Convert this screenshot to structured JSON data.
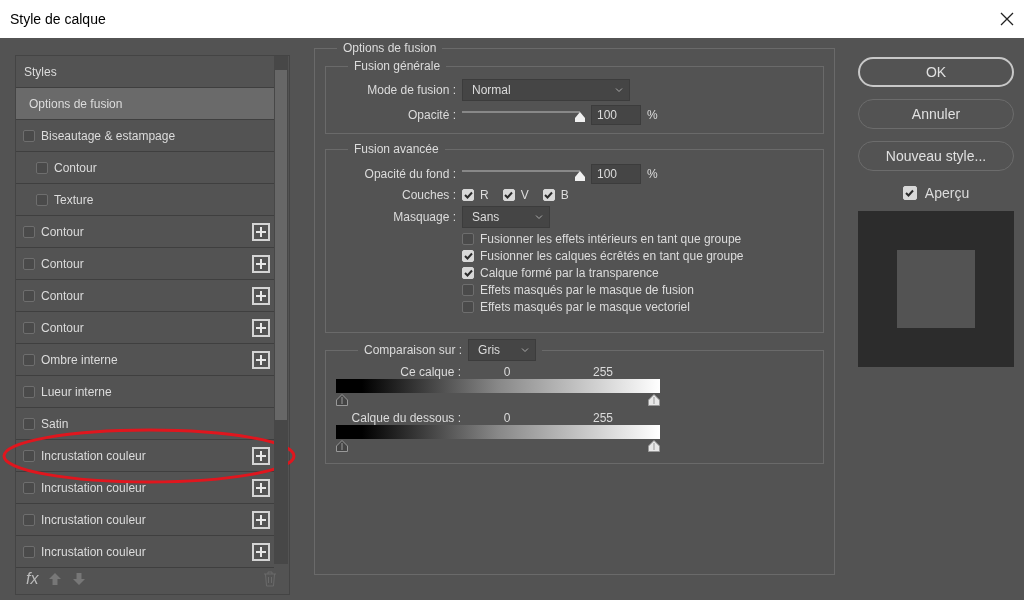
{
  "window": {
    "title": "Style de calque"
  },
  "styles_panel": {
    "header": "Styles",
    "fx": "fx",
    "items": [
      {
        "label": "Options de fusion",
        "kind": "page",
        "selected": true,
        "circled": false
      },
      {
        "label": "Biseautage & estampage",
        "kind": "effect",
        "checked": false,
        "selected": false,
        "circled": false,
        "children": [
          {
            "label": "Contour",
            "checked": false,
            "selected": false
          },
          {
            "label": "Texture",
            "checked": false,
            "selected": false
          }
        ]
      },
      {
        "label": "Contour",
        "kind": "stackable",
        "checked": false,
        "selected": false,
        "circled": false
      },
      {
        "label": "Contour",
        "kind": "stackable",
        "checked": false,
        "selected": false,
        "circled": false
      },
      {
        "label": "Contour",
        "kind": "stackable",
        "checked": false,
        "selected": false,
        "circled": false
      },
      {
        "label": "Contour",
        "kind": "stackable",
        "checked": false,
        "selected": false,
        "circled": false
      },
      {
        "label": "Ombre interne",
        "kind": "stackable",
        "checked": false,
        "selected": false,
        "circled": false
      },
      {
        "label": "Lueur interne",
        "kind": "effect",
        "checked": false,
        "selected": false,
        "circled": false
      },
      {
        "label": "Satin",
        "kind": "effect",
        "checked": false,
        "selected": false,
        "circled": false
      },
      {
        "label": "Incrustation couleur",
        "kind": "stackable",
        "checked": false,
        "selected": false,
        "circled": true
      },
      {
        "label": "Incrustation couleur",
        "kind": "stackable",
        "checked": false,
        "selected": false,
        "circled": false
      },
      {
        "label": "Incrustation couleur",
        "kind": "stackable",
        "checked": false,
        "selected": false,
        "circled": false
      },
      {
        "label": "Incrustation couleur",
        "kind": "stackable",
        "checked": false,
        "selected": false,
        "circled": false
      }
    ]
  },
  "blending": {
    "title": "Options de fusion",
    "general": {
      "title": "Fusion générale",
      "mode_label": "Mode de fusion :",
      "mode_value": "Normal",
      "opacity_label": "Opacité :",
      "opacity": {
        "level": 1,
        "value": "100",
        "unit": "%"
      }
    },
    "advanced": {
      "title": "Fusion avancée",
      "fill_label": "Opacité du fond :",
      "fill": {
        "level": 1,
        "value": "100",
        "unit": "%"
      },
      "channels_label": "Couches :",
      "channels": [
        {
          "label": "R",
          "checked": true
        },
        {
          "label": "V",
          "checked": true
        },
        {
          "label": "B",
          "checked": true
        }
      ],
      "knockout_label": "Masquage :",
      "knockout_value": "Sans",
      "options": [
        {
          "label": "Fusionner les effets intérieurs en tant que groupe",
          "checked": false
        },
        {
          "label": "Fusionner les calques écrêtés en tant que groupe",
          "checked": true
        },
        {
          "label": "Calque formé par la transparence",
          "checked": true
        },
        {
          "label": "Effets masqués par le masque de fusion",
          "checked": false
        },
        {
          "label": "Effets masqués par le masque vectoriel",
          "checked": false
        }
      ]
    },
    "blend_if": {
      "label": "Comparaison sur :",
      "value": "Gris",
      "ranges": [
        {
          "label": "Ce calque :",
          "low": "0",
          "high": "255",
          "thumbs": [
            {
              "level": 0
            },
            {
              "level": 1
            }
          ]
        },
        {
          "label": "Calque du dessous :",
          "low": "0",
          "high": "255",
          "thumbs": [
            {
              "level": 0
            },
            {
              "level": 1
            }
          ]
        }
      ]
    }
  },
  "buttons": [
    {
      "label": "OK",
      "default": true
    },
    {
      "label": "Annuler",
      "default": false
    },
    {
      "label": "Nouveau style...",
      "default": false
    }
  ],
  "preview": {
    "label": "Aperçu",
    "checked": true
  }
}
